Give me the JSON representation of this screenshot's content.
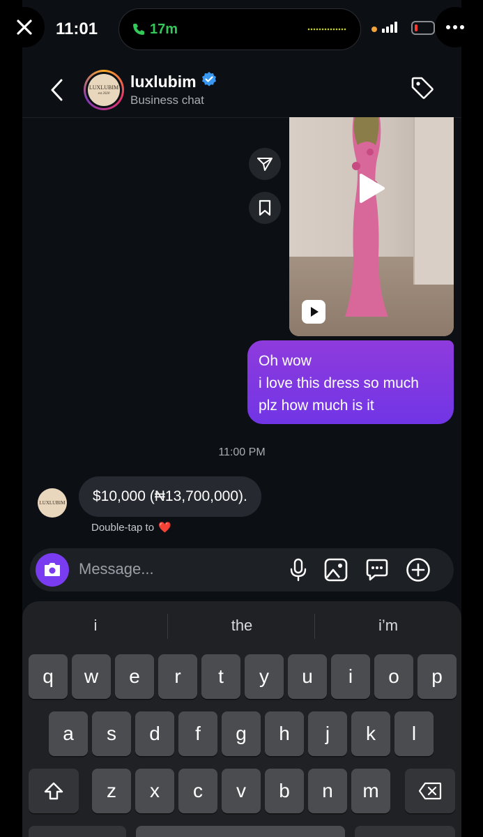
{
  "status_bar": {
    "time": "11:01",
    "call_duration": "17m"
  },
  "header": {
    "username": "luxlubim",
    "subtitle": "Business chat",
    "avatar_text": "LUXLUBIM",
    "avatar_subtext": "est 2020"
  },
  "messages": {
    "outgoing": [
      "Oh wow",
      "i love this dress so much",
      "plz how much is it"
    ],
    "timestamp": "11:00 PM",
    "incoming": "$10,000  (₦13,700,000).",
    "reaction_hint": "Double-tap to",
    "reaction_emoji": "❤️"
  },
  "composer": {
    "placeholder": "Message..."
  },
  "keyboard": {
    "suggestions": [
      "i",
      "the",
      "i’m"
    ],
    "row1": [
      "q",
      "w",
      "e",
      "r",
      "t",
      "y",
      "u",
      "i",
      "o",
      "p"
    ],
    "row2": [
      "a",
      "s",
      "d",
      "f",
      "g",
      "h",
      "j",
      "k",
      "l"
    ],
    "row3": [
      "z",
      "x",
      "c",
      "v",
      "b",
      "n",
      "m"
    ]
  },
  "colors": {
    "accent": "#7a3cf0",
    "bubble_out": "#8e3bdc",
    "call_green": "#34c759",
    "verified": "#3897f0"
  }
}
